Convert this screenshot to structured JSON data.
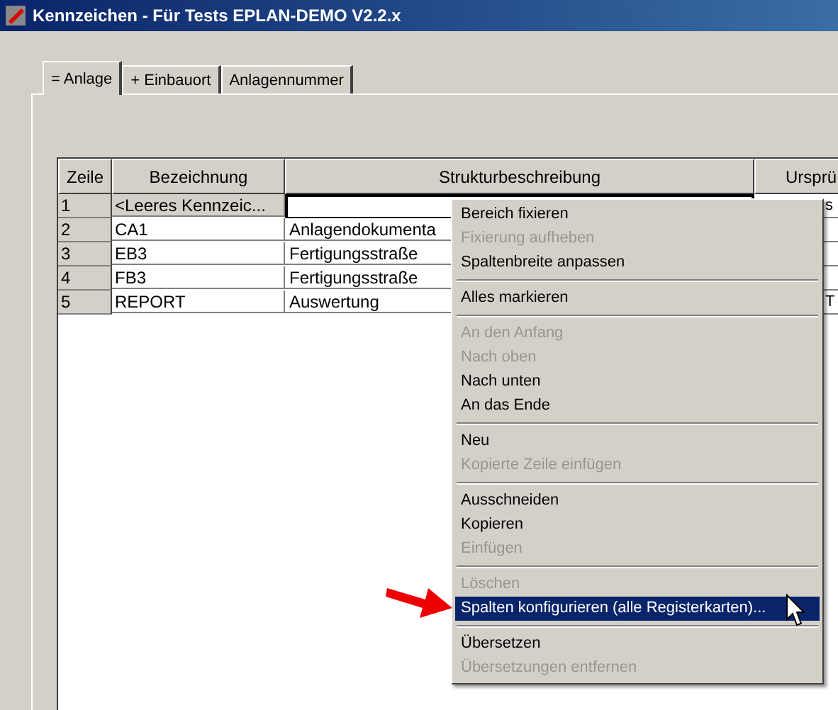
{
  "window": {
    "title": "Kennzeichen - Für Tests EPLAN-DEMO V2.2.x"
  },
  "tabs": [
    {
      "label": "= Anlage",
      "selected": true
    },
    {
      "label": "+ Einbauort",
      "selected": false
    },
    {
      "label": "Anlagennummer",
      "selected": false
    }
  ],
  "table": {
    "columns": [
      "Zeile",
      "Bezeichnung",
      "Strukturbeschreibung",
      "Ursprü"
    ],
    "rows": [
      {
        "cells": [
          "1",
          "<Leeres Kennzeic...",
          "",
          "s"
        ],
        "selected": true
      },
      {
        "cells": [
          "2",
          "CA1",
          "Anlagendokumenta",
          ""
        ],
        "selected": false
      },
      {
        "cells": [
          "3",
          "EB3",
          "Fertigungsstraße",
          ""
        ],
        "selected": false
      },
      {
        "cells": [
          "4",
          "FB3",
          "Fertigungsstraße",
          ""
        ],
        "selected": false
      },
      {
        "cells": [
          "5",
          "REPORT",
          "Auswertung",
          "T"
        ],
        "selected": false
      }
    ]
  },
  "context_menu": {
    "items": [
      {
        "kind": "item",
        "label": "Bereich fixieren",
        "disabled": false,
        "selected": false
      },
      {
        "kind": "item",
        "label": "Fixierung aufheben",
        "disabled": true,
        "selected": false
      },
      {
        "kind": "item",
        "label": "Spaltenbreite anpassen",
        "disabled": false,
        "selected": false
      },
      {
        "kind": "separator"
      },
      {
        "kind": "item",
        "label": "Alles markieren",
        "disabled": false,
        "selected": false
      },
      {
        "kind": "separator"
      },
      {
        "kind": "item",
        "label": "An den Anfang",
        "disabled": true,
        "selected": false
      },
      {
        "kind": "item",
        "label": "Nach oben",
        "disabled": true,
        "selected": false
      },
      {
        "kind": "item",
        "label": "Nach unten",
        "disabled": false,
        "selected": false
      },
      {
        "kind": "item",
        "label": "An das Ende",
        "disabled": false,
        "selected": false
      },
      {
        "kind": "separator"
      },
      {
        "kind": "item",
        "label": "Neu",
        "disabled": false,
        "selected": false
      },
      {
        "kind": "item",
        "label": "Kopierte Zeile einfügen",
        "disabled": true,
        "selected": false
      },
      {
        "kind": "separator"
      },
      {
        "kind": "item",
        "label": "Ausschneiden",
        "disabled": false,
        "selected": false
      },
      {
        "kind": "item",
        "label": "Kopieren",
        "disabled": false,
        "selected": false
      },
      {
        "kind": "item",
        "label": "Einfügen",
        "disabled": true,
        "selected": false
      },
      {
        "kind": "separator"
      },
      {
        "kind": "item",
        "label": "Löschen",
        "disabled": true,
        "selected": false
      },
      {
        "kind": "item",
        "label": "Spalten konfigurieren (alle Registerkarten)...",
        "disabled": false,
        "selected": true
      },
      {
        "kind": "separator"
      },
      {
        "kind": "item",
        "label": "Übersetzen",
        "disabled": false,
        "selected": false
      },
      {
        "kind": "item",
        "label": "Übersetzungen entfernen",
        "disabled": true,
        "selected": false
      }
    ]
  }
}
